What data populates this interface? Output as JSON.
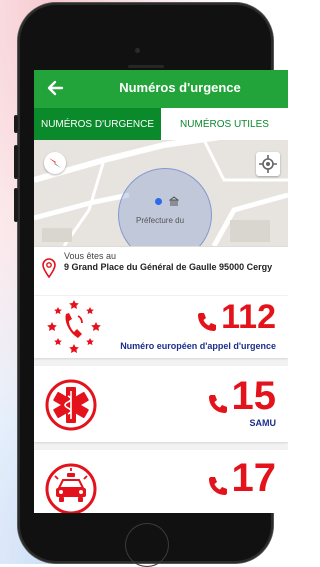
{
  "header": {
    "title": "Numéros d'urgence"
  },
  "tabs": [
    {
      "label": "NUMÉROS D'URGENCE",
      "active": true
    },
    {
      "label": "NUMÉROS UTILES",
      "active": false
    }
  ],
  "map": {
    "poi_label": "Préfecture du"
  },
  "location": {
    "prefix": "Vous êtes au",
    "address": "9 Grand Place du Général de Gaulle 95000 Cergy"
  },
  "numbers": [
    {
      "number": "112",
      "label": "Numéro européen d'appel d'urgence",
      "icon": "european-emergency-icon"
    },
    {
      "number": "15",
      "label": "SAMU",
      "icon": "medical-star-of-life-icon"
    },
    {
      "number": "17",
      "label": "",
      "icon": "police-car-icon"
    }
  ],
  "colors": {
    "app_green": "#23a43a",
    "tab_green": "#0a8a2a",
    "emergency_red": "#e3121b",
    "label_blue": "#1b2f8b"
  }
}
